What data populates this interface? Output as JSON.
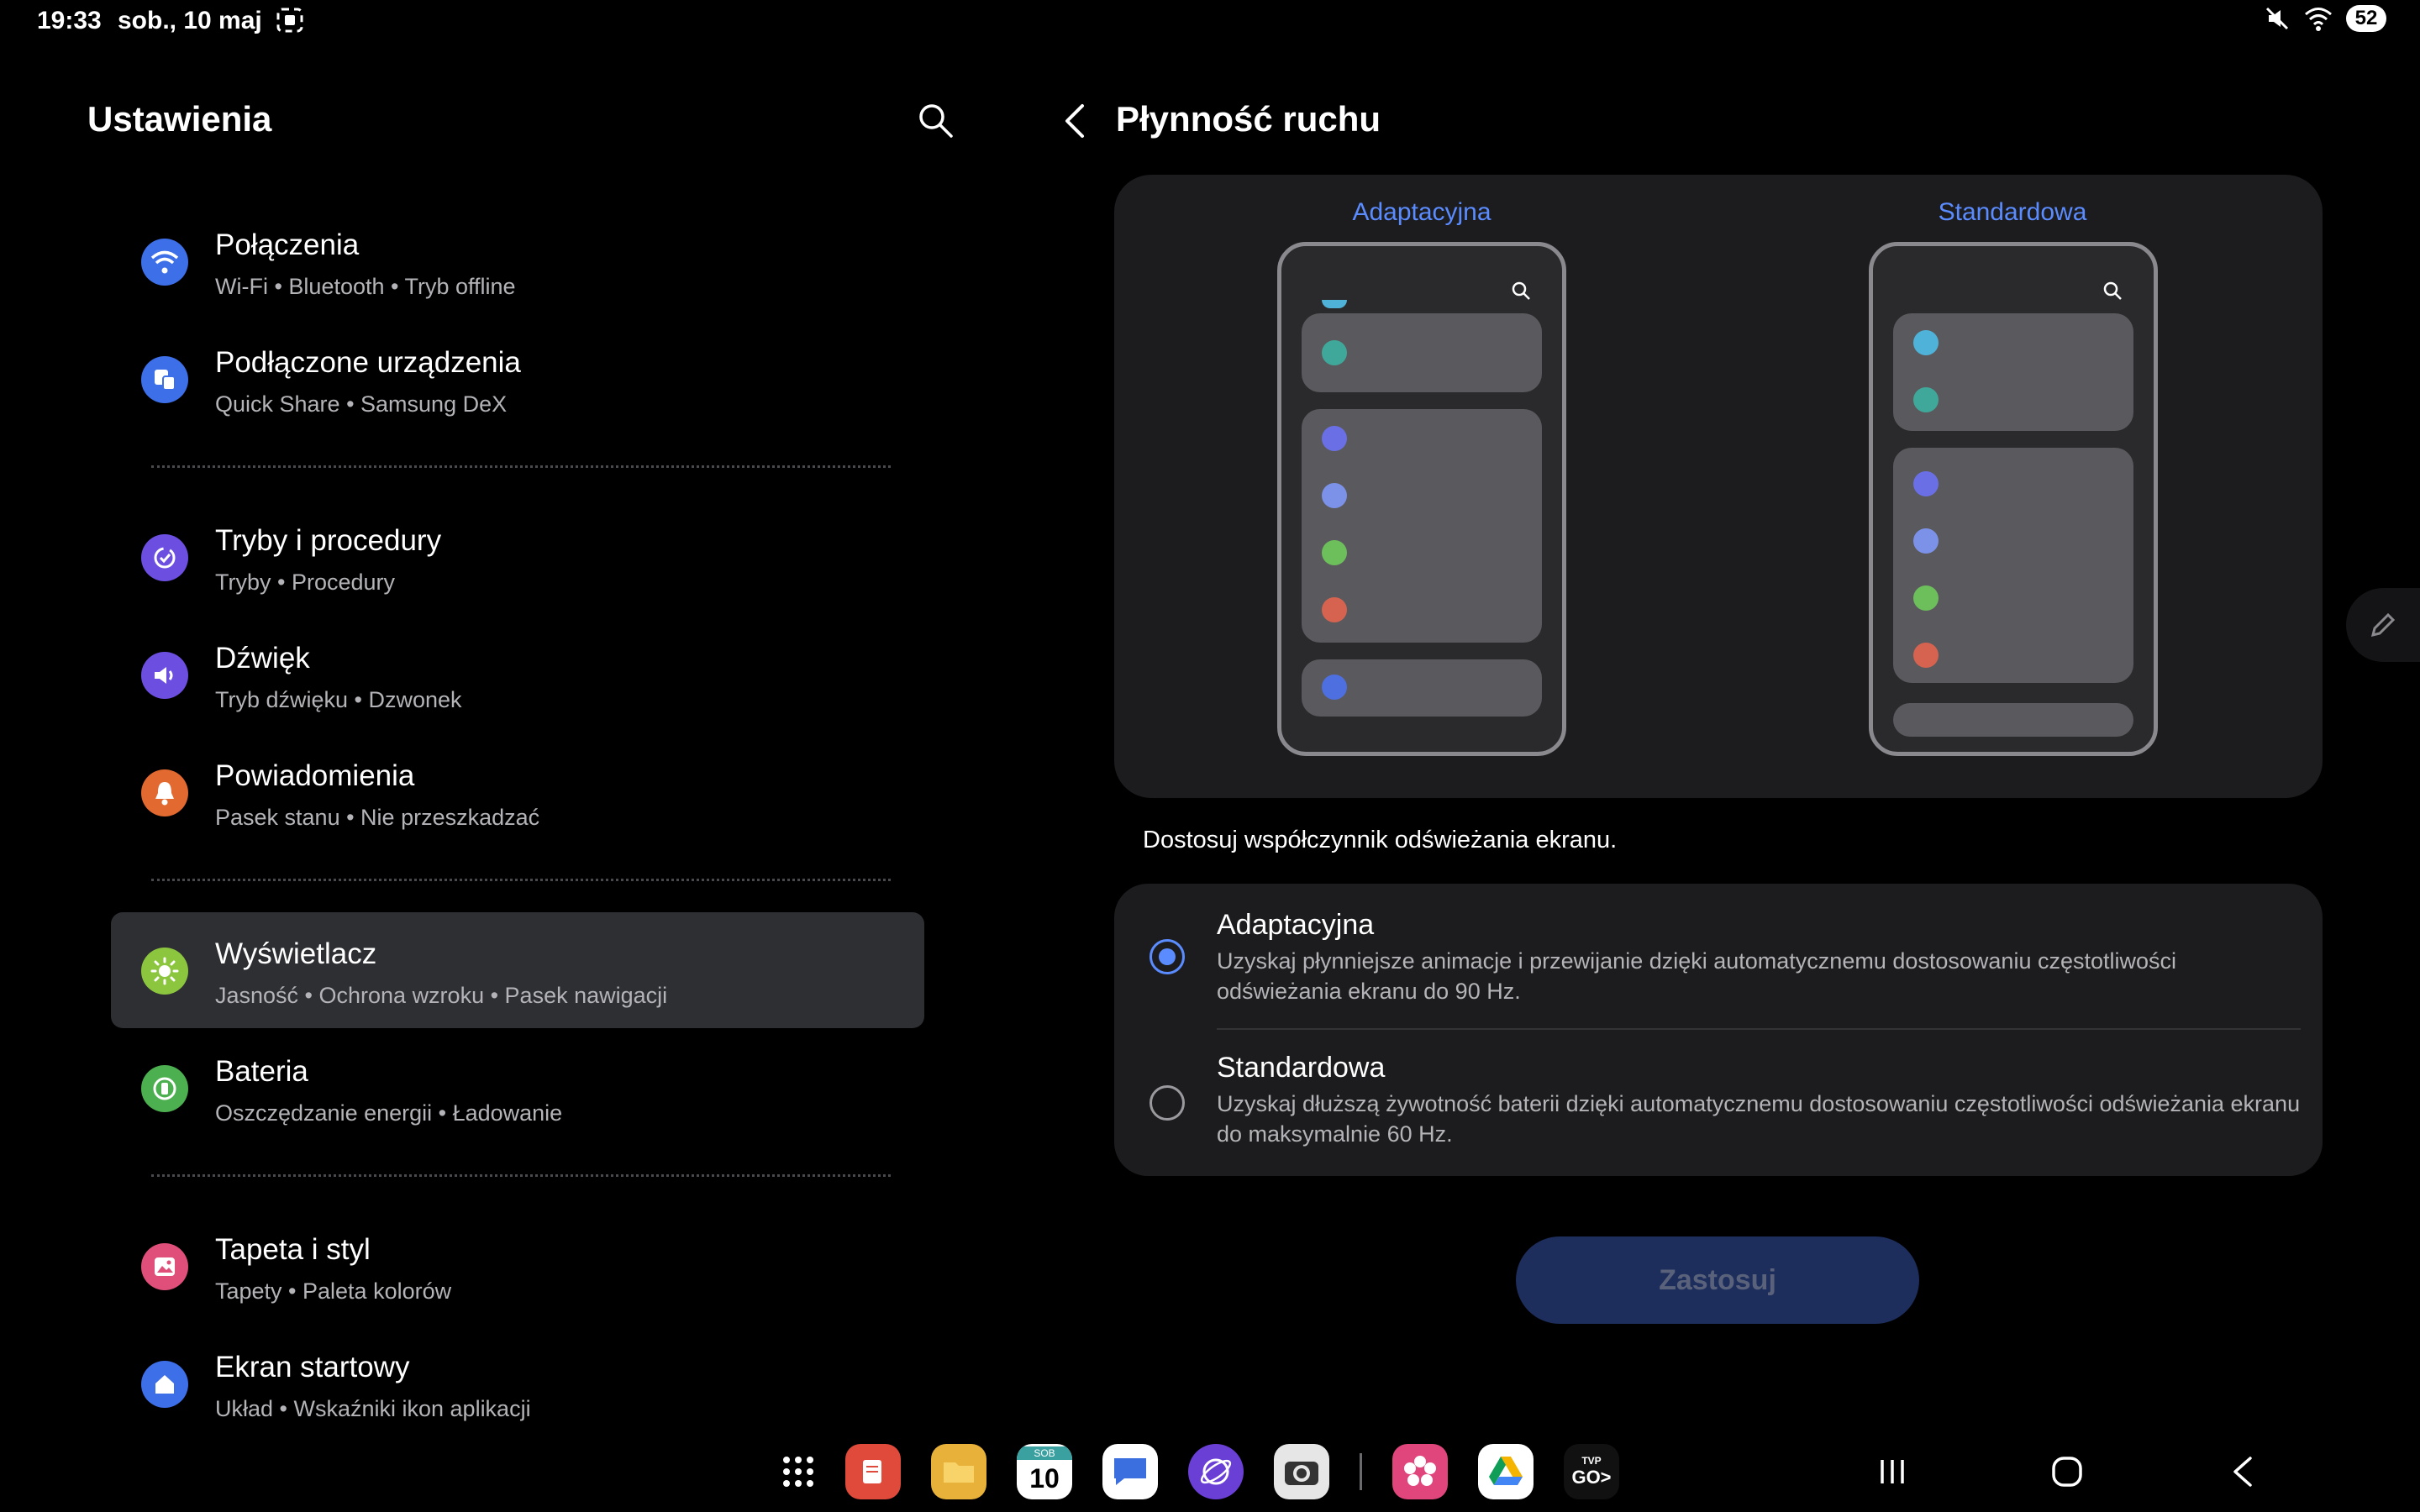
{
  "status": {
    "time": "19:33",
    "date": "sob., 10 maj",
    "battery": "52"
  },
  "left": {
    "title": "Ustawienia",
    "items": [
      {
        "title": "Połączenia",
        "sub": "Wi-Fi  •  Bluetooth  •  Tryb offline",
        "icon": "wifi-icon",
        "color": "#3d6fe8"
      },
      {
        "title": "Podłączone urządzenia",
        "sub": "Quick Share  •  Samsung DeX",
        "icon": "devices-icon",
        "color": "#3d6fe8"
      },
      {
        "title": "Tryby i procedury",
        "sub": "Tryby  •  Procedury",
        "icon": "modes-icon",
        "color": "#6c4fe0"
      },
      {
        "title": "Dźwięk",
        "sub": "Tryb dźwięku  •  Dzwonek",
        "icon": "volume-icon",
        "color": "#6c4fe0"
      },
      {
        "title": "Powiadomienia",
        "sub": "Pasek stanu  •  Nie przeszkadzać",
        "icon": "bell-icon",
        "color": "#e2692f"
      },
      {
        "title": "Wyświetlacz",
        "sub": "Jasność  •  Ochrona wzroku  •  Pasek nawigacji",
        "icon": "sun-icon",
        "color": "#8cc63f"
      },
      {
        "title": "Bateria",
        "sub": "Oszczędzanie energii  •  Ładowanie",
        "icon": "battery-icon",
        "color": "#4caf50"
      },
      {
        "title": "Tapeta i styl",
        "sub": "Tapety  •  Paleta kolorów",
        "icon": "wallpaper-icon",
        "color": "#e04f7a"
      },
      {
        "title": "Ekran startowy",
        "sub": "Układ  •  Wskaźniki ikon aplikacji",
        "icon": "home-icon",
        "color": "#3d6fe8"
      }
    ]
  },
  "right": {
    "title": "Płynność ruchu",
    "preview_labels": [
      "Adaptacyjna",
      "Standardowa"
    ],
    "hint": "Dostosuj współczynnik odświeżania ekranu.",
    "options": [
      {
        "title": "Adaptacyjna",
        "desc": "Uzyskaj płynniejsze animacje i przewijanie dzięki automatycznemu dostosowaniu częstotliwości odświeżania ekranu do 90 Hz.",
        "selected": true
      },
      {
        "title": "Standardowa",
        "desc": "Uzyskaj dłuższą żywotność baterii dzięki automatycznemu dostosowaniu częstotliwości odświeżania ekranu do maksymalnie 60 Hz.",
        "selected": false
      }
    ],
    "apply": "Zastosuj"
  },
  "colors": {
    "accent": "#5b8cff",
    "selected_bg": "#2e2f33"
  },
  "taskbar": {
    "calendar_day": "SOB",
    "calendar_date": "10",
    "tvp_label": "TVP",
    "tvp_go": "GO>"
  }
}
